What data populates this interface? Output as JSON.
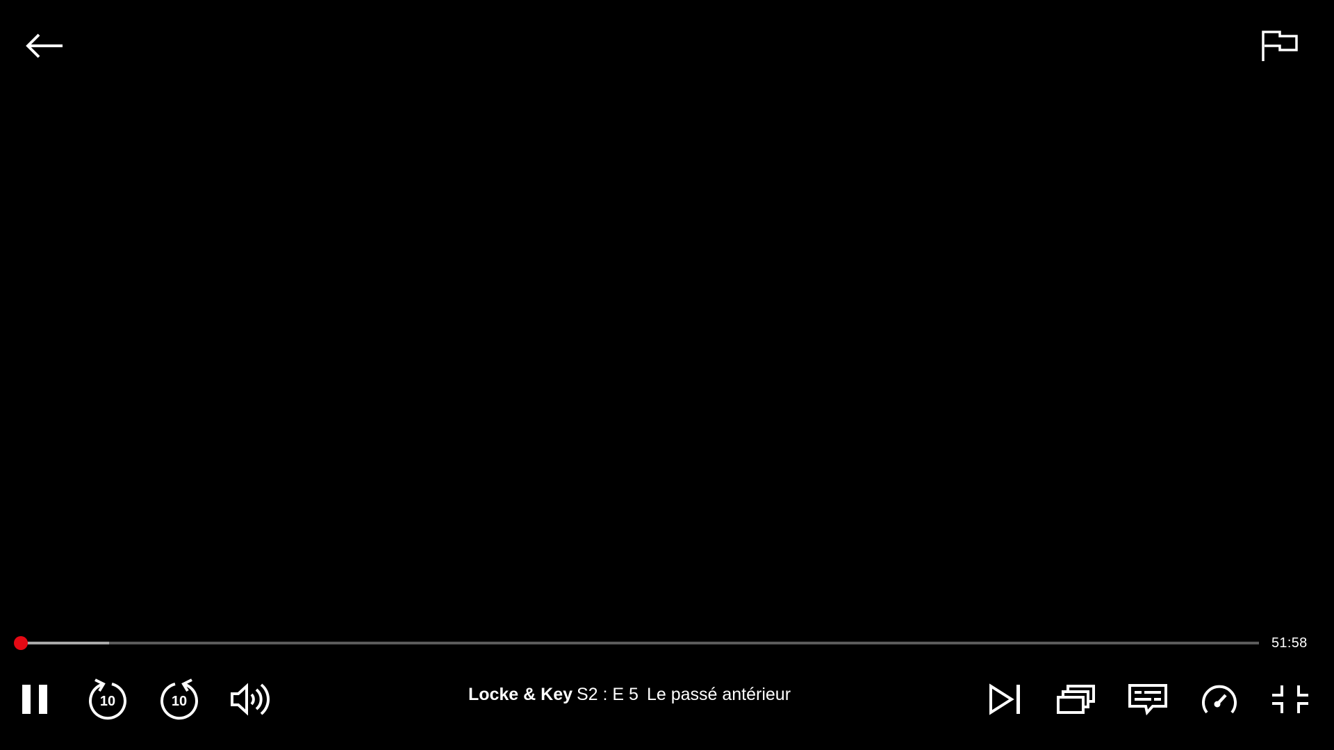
{
  "player": {
    "show_title": "Locke & Key",
    "episode_code": "S2 : E 5",
    "episode_title": "Le passé antérieur",
    "time_remaining": "51:58",
    "progress_fraction": 0.0,
    "buffered_fraction": 0.071
  },
  "icons": {
    "back": "arrow-left-icon",
    "report": "flag-icon",
    "pause": "pause-icon",
    "rewind": "rewind-10-icon",
    "forward": "forward-10-icon",
    "volume": "volume-icon",
    "next": "next-episode-icon",
    "episodes": "episodes-icon",
    "subtitles": "subtitles-icon",
    "speed": "playback-speed-icon",
    "exit_fullscreen": "exit-fullscreen-icon"
  },
  "labels": {
    "rewind_seconds": "10",
    "forward_seconds": "10"
  },
  "colors": {
    "background": "#000000",
    "accent": "#e50914",
    "track": "#5b5b5b",
    "buffer": "#a9a9a9",
    "foreground": "#ffffff"
  }
}
